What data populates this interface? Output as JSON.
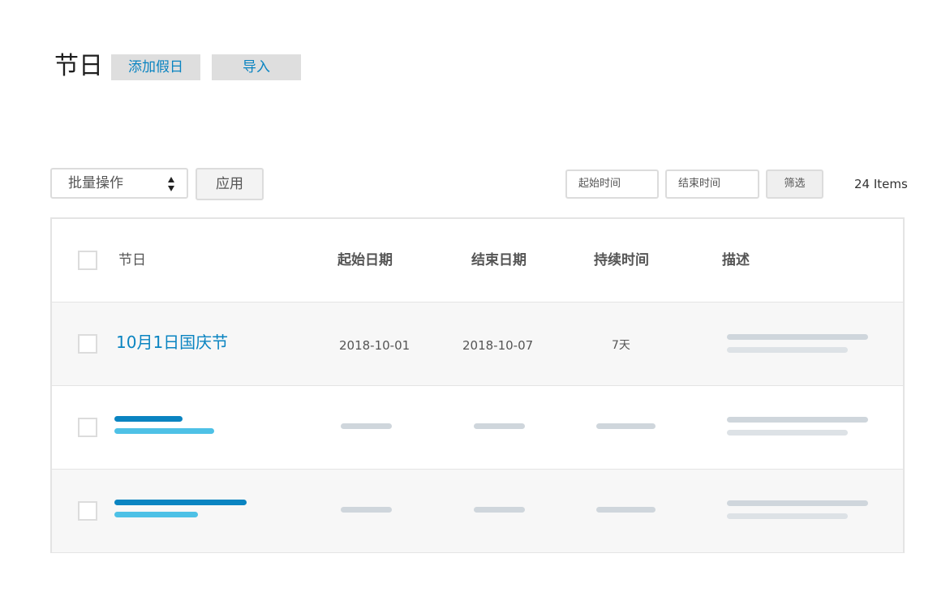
{
  "header": {
    "title": "节日",
    "add_holiday_label": "添加假日",
    "import_label": "导入"
  },
  "toolbar": {
    "bulk_action_label": "批量操作",
    "apply_label": "应用",
    "start_time_placeholder": "起始时间",
    "end_time_placeholder": "结束时间",
    "filter_label": "筛选",
    "items_count": "24 Items"
  },
  "table": {
    "columns": [
      "节日",
      "起始日期",
      "结束日期",
      "持续时间",
      "描述"
    ],
    "rows": [
      {
        "name": "10月1日国庆节",
        "start_date": "2018-10-01",
        "end_date": "2018-10-07",
        "duration": "7天"
      }
    ]
  },
  "colors": {
    "accent": "#0a84c1",
    "accent_light": "#4ec1e6",
    "placeholder_gray": "#cfd6dc",
    "row_alt_bg": "#f7f7f7",
    "border": "#e4e4e4"
  }
}
